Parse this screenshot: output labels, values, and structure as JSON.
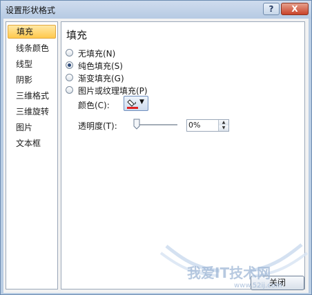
{
  "window": {
    "title": "设置形状格式",
    "help_glyph": "?",
    "close_glyph": "X"
  },
  "sidebar": {
    "items": [
      {
        "label": "填充",
        "selected": true
      },
      {
        "label": "线条颜色",
        "selected": false
      },
      {
        "label": "线型",
        "selected": false
      },
      {
        "label": "阴影",
        "selected": false
      },
      {
        "label": "三维格式",
        "selected": false
      },
      {
        "label": "三维旋转",
        "selected": false
      },
      {
        "label": "图片",
        "selected": false
      },
      {
        "label": "文本框",
        "selected": false
      }
    ]
  },
  "panel": {
    "title": "填充",
    "fill_options": [
      {
        "label": "无填充(N)",
        "checked": false
      },
      {
        "label": "纯色填充(S)",
        "checked": true
      },
      {
        "label": "渐变填充(G)",
        "checked": false
      },
      {
        "label": "图片或纹理填充(P)",
        "checked": false
      }
    ],
    "color_label": "颜色(C):",
    "color_swatch": "#e02020",
    "dropdown_glyph": "▼",
    "transparency_label": "透明度(T):",
    "transparency_value": "0%",
    "transparency_fraction": 0,
    "spin_up": "▲",
    "spin_down": "▼"
  },
  "footer": {
    "close_label": "关闭"
  },
  "watermark": {
    "text": "我爱IT技术网",
    "url": "www.52ij.com"
  }
}
